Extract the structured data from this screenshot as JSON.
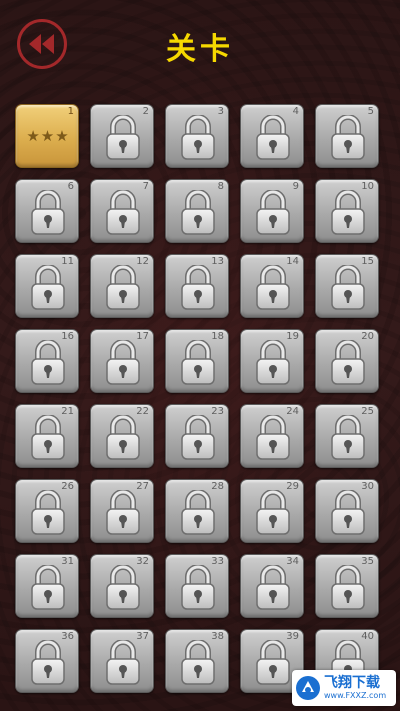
{
  "header": {
    "title": "关卡",
    "back_icon": "rewind-back-icon"
  },
  "levels": [
    {
      "number": "1",
      "state": "unlocked",
      "stars": "★★★"
    },
    {
      "number": "2",
      "state": "locked"
    },
    {
      "number": "3",
      "state": "locked"
    },
    {
      "number": "4",
      "state": "locked"
    },
    {
      "number": "5",
      "state": "locked"
    },
    {
      "number": "6",
      "state": "locked"
    },
    {
      "number": "7",
      "state": "locked"
    },
    {
      "number": "8",
      "state": "locked"
    },
    {
      "number": "9",
      "state": "locked"
    },
    {
      "number": "10",
      "state": "locked"
    },
    {
      "number": "11",
      "state": "locked"
    },
    {
      "number": "12",
      "state": "locked"
    },
    {
      "number": "13",
      "state": "locked"
    },
    {
      "number": "14",
      "state": "locked"
    },
    {
      "number": "15",
      "state": "locked"
    },
    {
      "number": "16",
      "state": "locked"
    },
    {
      "number": "17",
      "state": "locked"
    },
    {
      "number": "18",
      "state": "locked"
    },
    {
      "number": "19",
      "state": "locked"
    },
    {
      "number": "20",
      "state": "locked"
    },
    {
      "number": "21",
      "state": "locked"
    },
    {
      "number": "22",
      "state": "locked"
    },
    {
      "number": "23",
      "state": "locked"
    },
    {
      "number": "24",
      "state": "locked"
    },
    {
      "number": "25",
      "state": "locked"
    },
    {
      "number": "26",
      "state": "locked"
    },
    {
      "number": "27",
      "state": "locked"
    },
    {
      "number": "28",
      "state": "locked"
    },
    {
      "number": "29",
      "state": "locked"
    },
    {
      "number": "30",
      "state": "locked"
    },
    {
      "number": "31",
      "state": "locked"
    },
    {
      "number": "32",
      "state": "locked"
    },
    {
      "number": "33",
      "state": "locked"
    },
    {
      "number": "34",
      "state": "locked"
    },
    {
      "number": "35",
      "state": "locked"
    },
    {
      "number": "36",
      "state": "locked"
    },
    {
      "number": "37",
      "state": "locked"
    },
    {
      "number": "38",
      "state": "locked"
    },
    {
      "number": "39",
      "state": "locked"
    },
    {
      "number": "40",
      "state": "locked"
    }
  ],
  "watermark": {
    "name": "飞翔下载",
    "url": "www.FXXZ.com"
  },
  "colors": {
    "title": "#f6d800",
    "back_ring": "#a3282a",
    "background": "#2a1414",
    "unlocked_tile": "#dcae4e",
    "locked_tile": "#a9a9a9"
  }
}
